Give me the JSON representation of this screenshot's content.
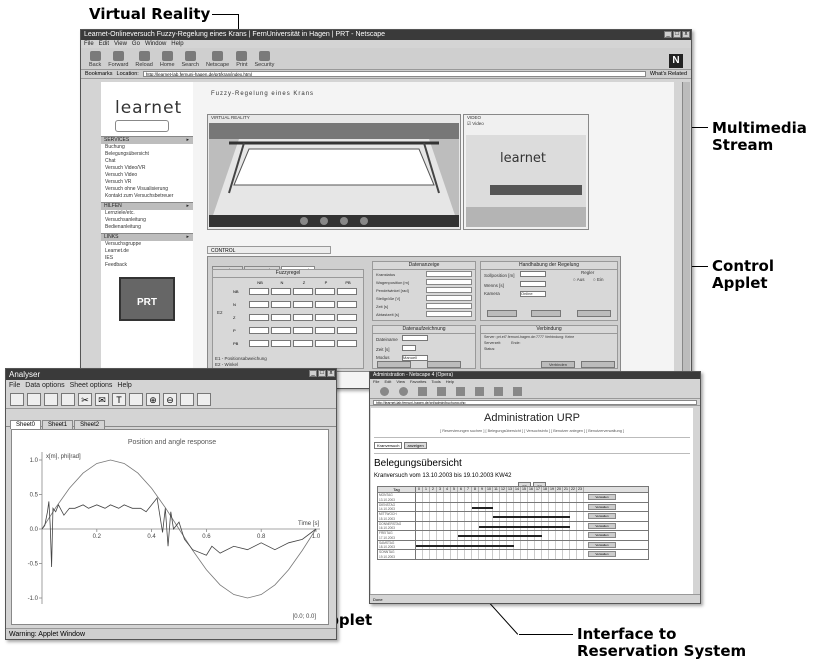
{
  "callouts": {
    "virtual_reality": "Virtual Reality",
    "multimedia_stream": "Multimedia Stream",
    "control_applet": "Control Applet",
    "analyser_applet": "Anaylser Applet",
    "reservation_interface": "Interface to Reservation System"
  },
  "browser": {
    "title": "Learnet-Onlineversuch Fuzzy-Regelung eines Krans | FernUniversität in Hagen | PRT - Netscape",
    "menu": [
      "File",
      "Edit",
      "View",
      "Go",
      "Window",
      "Help"
    ],
    "toolbar": [
      "Back",
      "Forward",
      "Reload",
      "Home",
      "Search",
      "Netscape",
      "Print",
      "Security"
    ],
    "bookmarks": "Bookmarks",
    "location_label": "Location:",
    "url": "http://learnet-lab.fernuni-hagen.de/prt/kran/index.html",
    "whats_related": "What's Related",
    "page_heading": "Fuzzy-Regelung eines Krans",
    "logo": "learnet",
    "sidebar_sections": [
      {
        "title": "SERVICES",
        "items": [
          "Buchung",
          "Belegungsübersicht",
          "Chat",
          "Versuch Video/VR",
          "Versuch Video",
          "Versuch VR",
          "Versuch ohne Visualisierung",
          "Kontakt zum Versuchsbetreuer"
        ]
      },
      {
        "title": "HILFEN",
        "items": [
          "Lernziele/etc.",
          "Versuchsanleitung",
          "Bedienanleitung"
        ]
      },
      {
        "title": "LINKS",
        "items": [
          "Versuchsgruppe",
          "Learnet.de",
          "IES",
          "Feedback"
        ]
      }
    ],
    "badge": "PRT",
    "vr_label": "VIRTUAL REALITY",
    "video_label": "VIDEO",
    "video_check": "Video",
    "control_tab": "CONTROL",
    "control_tabs": [
      "Regelung",
      "Fuzzyregler",
      "Fuzzyregel"
    ],
    "fuzzy_title": "Fuzzyregel",
    "fuzzy_cols": [
      "NB",
      "N",
      "Z",
      "P",
      "PB"
    ],
    "fuzzy_rows": [
      "NB",
      "N",
      "Z",
      "P",
      "PB"
    ],
    "fuzzy_side_label": "E2",
    "fuzzy_notes": [
      "E1 - Positionsabweichung",
      "E2 - Winkel"
    ],
    "datenanzeige": {
      "title": "Datenanzeige",
      "rows": [
        "Kranstatus",
        "Wagenposition [m]",
        "Pendelwinkel [rad]",
        "Stellgröße [V]",
        "Zeit [s]",
        "Abtastzeit [s]"
      ]
    },
    "handhabung": {
      "title": "Handhabung der Regelung",
      "fields": [
        "Sollposition [m]",
        "Wenns [s]",
        "Kamera"
      ],
      "camera_value": "Online",
      "regler_label": "Regler",
      "aus": "Aus",
      "ein": "Ein"
    },
    "speicherung": {
      "title": "Datenaufzeichnung",
      "fields": [
        "Dateiname",
        "Zeit [s]",
        "Modus"
      ],
      "modus_value": "Manuell"
    },
    "verbindung": {
      "title": "Verbindung",
      "lines": [
        "Server: prt.et7.fernuni-hagen.de:7777 Verbindung: Keine",
        "Serverzeit:          Ende:",
        "Status:"
      ],
      "button": "Verbinden"
    }
  },
  "analyser": {
    "title": "Analyser",
    "menu": [
      "File",
      "Data options",
      "Sheet options",
      "Help"
    ],
    "tabs": [
      "Sheet0",
      "Sheet1",
      "Sheet2"
    ],
    "active_tab": "Sheet0",
    "status": "Warning: Applet Window"
  },
  "chart_data": {
    "type": "line",
    "title": "Position and angle response",
    "ylabel": "x[m], phi[rad]",
    "xlabel": "Time [s]",
    "xlim": [
      0,
      1.0
    ],
    "ylim": [
      -1.0,
      1.0
    ],
    "x_ticks": [
      "0.2",
      "0.4",
      "0.6",
      "0.8",
      "1.0"
    ],
    "y_ticks": [
      "1.0",
      "0.5",
      "0.0",
      "-0.5",
      "-1.0"
    ],
    "corner_label": "[0.0; 0.0]",
    "series": [
      {
        "values": [
          [
            0,
            0.0
          ],
          [
            0.05,
            0.31
          ],
          [
            0.1,
            0.59
          ],
          [
            0.15,
            0.81
          ],
          [
            0.2,
            0.95
          ],
          [
            0.25,
            1.0
          ],
          [
            0.3,
            0.95
          ],
          [
            0.35,
            0.81
          ],
          [
            0.4,
            0.59
          ],
          [
            0.45,
            0.31
          ],
          [
            0.5,
            0.0
          ],
          [
            0.55,
            -0.31
          ],
          [
            0.6,
            -0.59
          ],
          [
            0.65,
            -0.81
          ],
          [
            0.7,
            -0.95
          ],
          [
            0.75,
            -1.0
          ],
          [
            0.8,
            -0.95
          ],
          [
            0.85,
            -0.81
          ],
          [
            0.9,
            -0.59
          ],
          [
            0.95,
            -0.31
          ],
          [
            1.0,
            0.0
          ]
        ]
      },
      {
        "values": [
          [
            0,
            0.0
          ],
          [
            0.01,
            0.05
          ],
          [
            0.02,
            0.25
          ],
          [
            0.025,
            0.4
          ],
          [
            0.03,
            0.05
          ],
          [
            0.035,
            -0.55
          ],
          [
            0.04,
            0.3
          ],
          [
            0.05,
            0.25
          ],
          [
            0.06,
            0.35
          ],
          [
            0.08,
            0.2
          ],
          [
            0.1,
            0.3
          ],
          [
            0.12,
            0.3
          ],
          [
            0.15,
            0.35
          ],
          [
            0.17,
            0.3
          ],
          [
            0.2,
            0.35
          ],
          [
            0.23,
            0.3
          ],
          [
            0.25,
            0.35
          ],
          [
            0.28,
            0.3
          ],
          [
            0.3,
            0.35
          ],
          [
            0.33,
            0.3
          ],
          [
            0.36,
            0.3
          ],
          [
            0.38,
            0.25
          ],
          [
            0.4,
            0.35
          ],
          [
            0.42,
            0.45
          ],
          [
            0.43,
            0.2
          ],
          [
            0.44,
            -0.05
          ],
          [
            0.45,
            0.3
          ],
          [
            0.46,
            -0.25
          ],
          [
            0.47,
            0.25
          ],
          [
            0.48,
            0.0
          ],
          [
            0.5,
            0.1
          ],
          [
            0.52,
            -0.15
          ],
          [
            0.55,
            -0.3
          ],
          [
            0.6,
            -0.38
          ],
          [
            0.62,
            -0.25
          ],
          [
            0.65,
            -0.35
          ],
          [
            0.7,
            -0.25
          ],
          [
            0.75,
            -0.3
          ],
          [
            0.8,
            -0.2
          ],
          [
            0.85,
            -0.3
          ],
          [
            0.9,
            -0.2
          ],
          [
            0.95,
            -0.15
          ],
          [
            1.0,
            0.0
          ]
        ]
      }
    ]
  },
  "reservation": {
    "title": "Administration - Netscape 4 (Opera)",
    "menu": [
      "File",
      "Edit",
      "View",
      "Favorites",
      "Tools",
      "Help"
    ],
    "url": "http://learnet-lab.fernuni-hagen.de/prt/admin/buchung.php",
    "heading": "Administration URP",
    "links": "[ Reservierungen suchen ] [ Belegungsübersicht ] [ Versuchsinfo ] [ Benutzer anlegen ] [ Benutzerverwaltung ]",
    "select_value": "Kranversuch",
    "select_button": "anzeigen",
    "section_title": "Belegungsübersicht",
    "subtitle": "Kranversuch vom 13.10.2003 bis 19.10.2003  KW42",
    "week_buttons": [
      "<<",
      ">>"
    ],
    "hours_label": "Tag",
    "hours": [
      "0",
      "1",
      "2",
      "3",
      "4",
      "5",
      "6",
      "7",
      "8",
      "9",
      "10",
      "11",
      "12",
      "13",
      "14",
      "15",
      "16",
      "17",
      "18",
      "19",
      "20",
      "21",
      "22",
      "23"
    ],
    "days": [
      {
        "name": "MONTAG",
        "date": "13.10.2003",
        "action": "Verwalten"
      },
      {
        "name": "DIENSTAG",
        "date": "14.10.2003",
        "action": "Verwalten"
      },
      {
        "name": "MITTWOCH",
        "date": "15.10.2003",
        "action": "Verwalten"
      },
      {
        "name": "DONNERSTAG",
        "date": "16.10.2003",
        "action": "Verwalten"
      },
      {
        "name": "FREITAG",
        "date": "17.10.2003",
        "action": "Verwalten"
      },
      {
        "name": "SAMSTAG",
        "date": "18.10.2003",
        "action": "Verwalten"
      },
      {
        "name": "SONNTAG",
        "date": "19.10.2003",
        "action": "Verwalten"
      }
    ],
    "bookings": [
      [],
      [
        [
          8,
          11
        ]
      ],
      [
        [
          11,
          22
        ]
      ],
      [
        [
          9,
          22
        ]
      ],
      [
        [
          6,
          18
        ]
      ],
      [
        [
          0,
          14
        ]
      ],
      []
    ],
    "status": "Done"
  }
}
